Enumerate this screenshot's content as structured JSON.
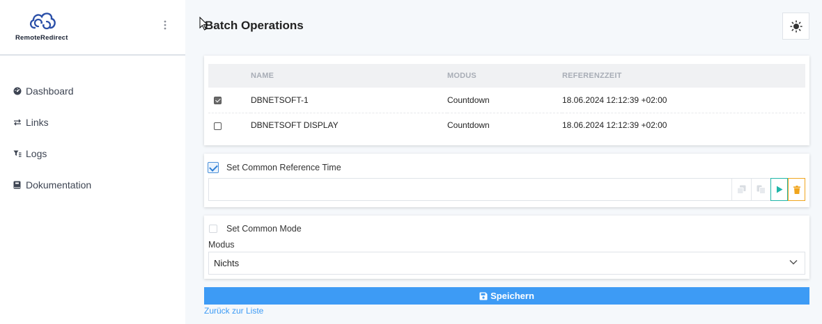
{
  "brand": {
    "name": "RemoteRedirect"
  },
  "sidebar": {
    "items": [
      {
        "label": "Dashboard",
        "icon": "dashboard-icon"
      },
      {
        "label": "Links",
        "icon": "arrows-exchange-icon"
      },
      {
        "label": "Logs",
        "icon": "filter-list-icon"
      },
      {
        "label": "Dokumentation",
        "icon": "book-icon"
      }
    ]
  },
  "header": {
    "title": "Batch Operations",
    "theme_icon": "sun-icon"
  },
  "table": {
    "columns": [
      "NAME",
      "MODUS",
      "REFERENZZEIT"
    ],
    "rows": [
      {
        "checked": true,
        "name": "DBNETSOFT-1",
        "modus": "Countdown",
        "referenzzeit": "18.06.2024 12:12:39 +02:00"
      },
      {
        "checked": false,
        "name": "DBNETSOFT DISPLAY",
        "modus": "Countdown",
        "referenzzeit": "18.06.2024 12:12:39 +02:00"
      }
    ]
  },
  "reference_time": {
    "label": "Set Common Reference Time",
    "checked": true,
    "value": ""
  },
  "mode": {
    "label": "Set Common Mode",
    "checked": false,
    "field_label": "Modus",
    "selected": "Nichts"
  },
  "actions": {
    "save_label": "Speichern",
    "back_label": "Zurück zur Liste"
  },
  "colors": {
    "primary": "#3d9bf5",
    "play": "#1fb5a8",
    "delete": "#f0a51d",
    "sidebar_bg": "#ffffff",
    "page_bg": "#f5f8fb"
  }
}
